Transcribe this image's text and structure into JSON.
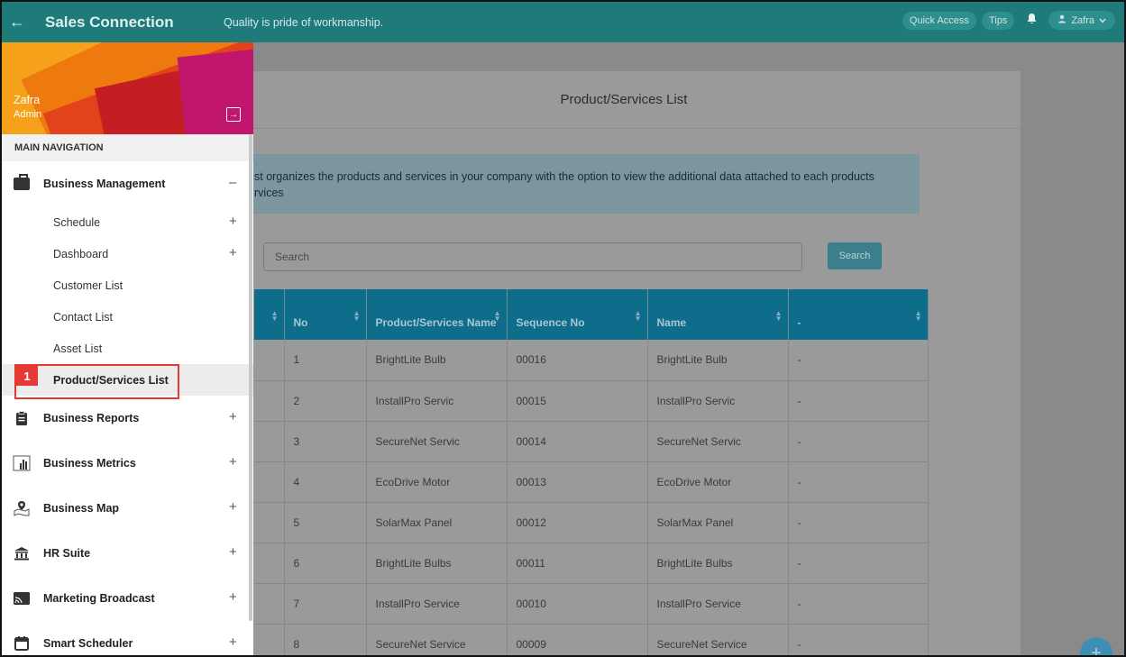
{
  "topbar": {
    "back_glyph": "←",
    "title": "Sales Connection",
    "tagline": "Quality is pride of workmanship.",
    "quick_access": "Quick Access",
    "tips": "Tips",
    "user": "Zafra"
  },
  "profile": {
    "name": "Zafra",
    "role": "Admin"
  },
  "nav": {
    "header": "MAIN NAVIGATION",
    "business_management": "Business Management",
    "schedule": "Schedule",
    "dashboard": "Dashboard",
    "customer_list": "Customer List",
    "contact_list": "Contact List",
    "asset_list": "Asset List",
    "product_services_list": "Product/Services List",
    "business_reports": "Business Reports",
    "business_metrics": "Business Metrics",
    "business_map": "Business Map",
    "hr_suite": "HR Suite",
    "marketing_broadcast": "Marketing Broadcast",
    "smart_scheduler": "Smart Scheduler"
  },
  "annotation": {
    "step": "1"
  },
  "page": {
    "title": "Product/Services List",
    "info_line1": "st organizes the products and services in your company with the option to view the additional data attached to each products",
    "info_line2": "rvices",
    "search_placeholder": "Search",
    "search_button": "Search"
  },
  "table": {
    "headers": [
      "",
      "No",
      "Product/Services Name",
      "Sequence No",
      "Name",
      "-"
    ],
    "rows": [
      [
        "",
        "1",
        "BrightLite Bulb",
        "00016",
        "BrightLite Bulb",
        "-"
      ],
      [
        "",
        "2",
        "InstallPro Servic",
        "00015",
        "InstallPro Servic",
        "-"
      ],
      [
        "",
        "3",
        "SecureNet Servic",
        "00014",
        "SecureNet Servic",
        "-"
      ],
      [
        "",
        "4",
        "EcoDrive Motor",
        "00013",
        "EcoDrive Motor",
        "-"
      ],
      [
        "",
        "5",
        "SolarMax Panel",
        "00012",
        "SolarMax Panel",
        "-"
      ],
      [
        "",
        "6",
        "BrightLite Bulbs",
        "00011",
        "BrightLite Bulbs",
        "-"
      ],
      [
        "",
        "7",
        "InstallPro Service",
        "00010",
        "InstallPro Service",
        "-"
      ],
      [
        "",
        "8",
        "SecureNet Service",
        "00009",
        "SecureNet Service",
        "-"
      ]
    ]
  },
  "colors": {
    "topbar": "#1f7a7a",
    "table_header": "#0f6d8c",
    "highlight": "#e53935"
  }
}
